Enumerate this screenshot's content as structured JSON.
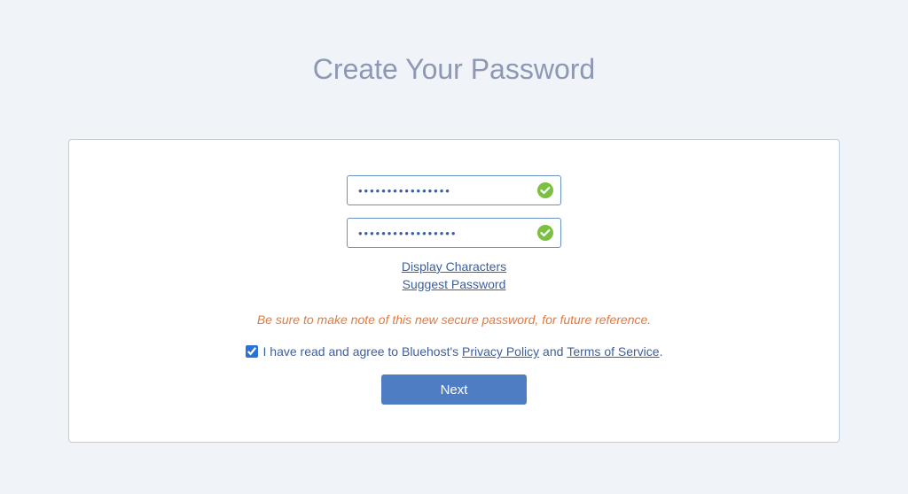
{
  "title": "Create Your Password",
  "form": {
    "password_value": "••••••••••••••••",
    "confirm_value": "•••••••••••••••••",
    "display_characters_label": "Display Characters",
    "suggest_password_label": "Suggest Password",
    "hint_text": "Be sure to make note of this new secure password, for future reference.",
    "agree_checked": true,
    "agree_prefix": "I have read and agree to Bluehost's ",
    "privacy_policy_label": "Privacy Policy",
    "agree_middle": " and ",
    "terms_label": "Terms of Service",
    "agree_suffix": ".",
    "next_button_label": "Next"
  },
  "icons": {
    "valid": "checkmark-circle"
  },
  "colors": {
    "accent": "#4f7dc4",
    "success": "#7bc043",
    "warning": "#e17a3e"
  }
}
